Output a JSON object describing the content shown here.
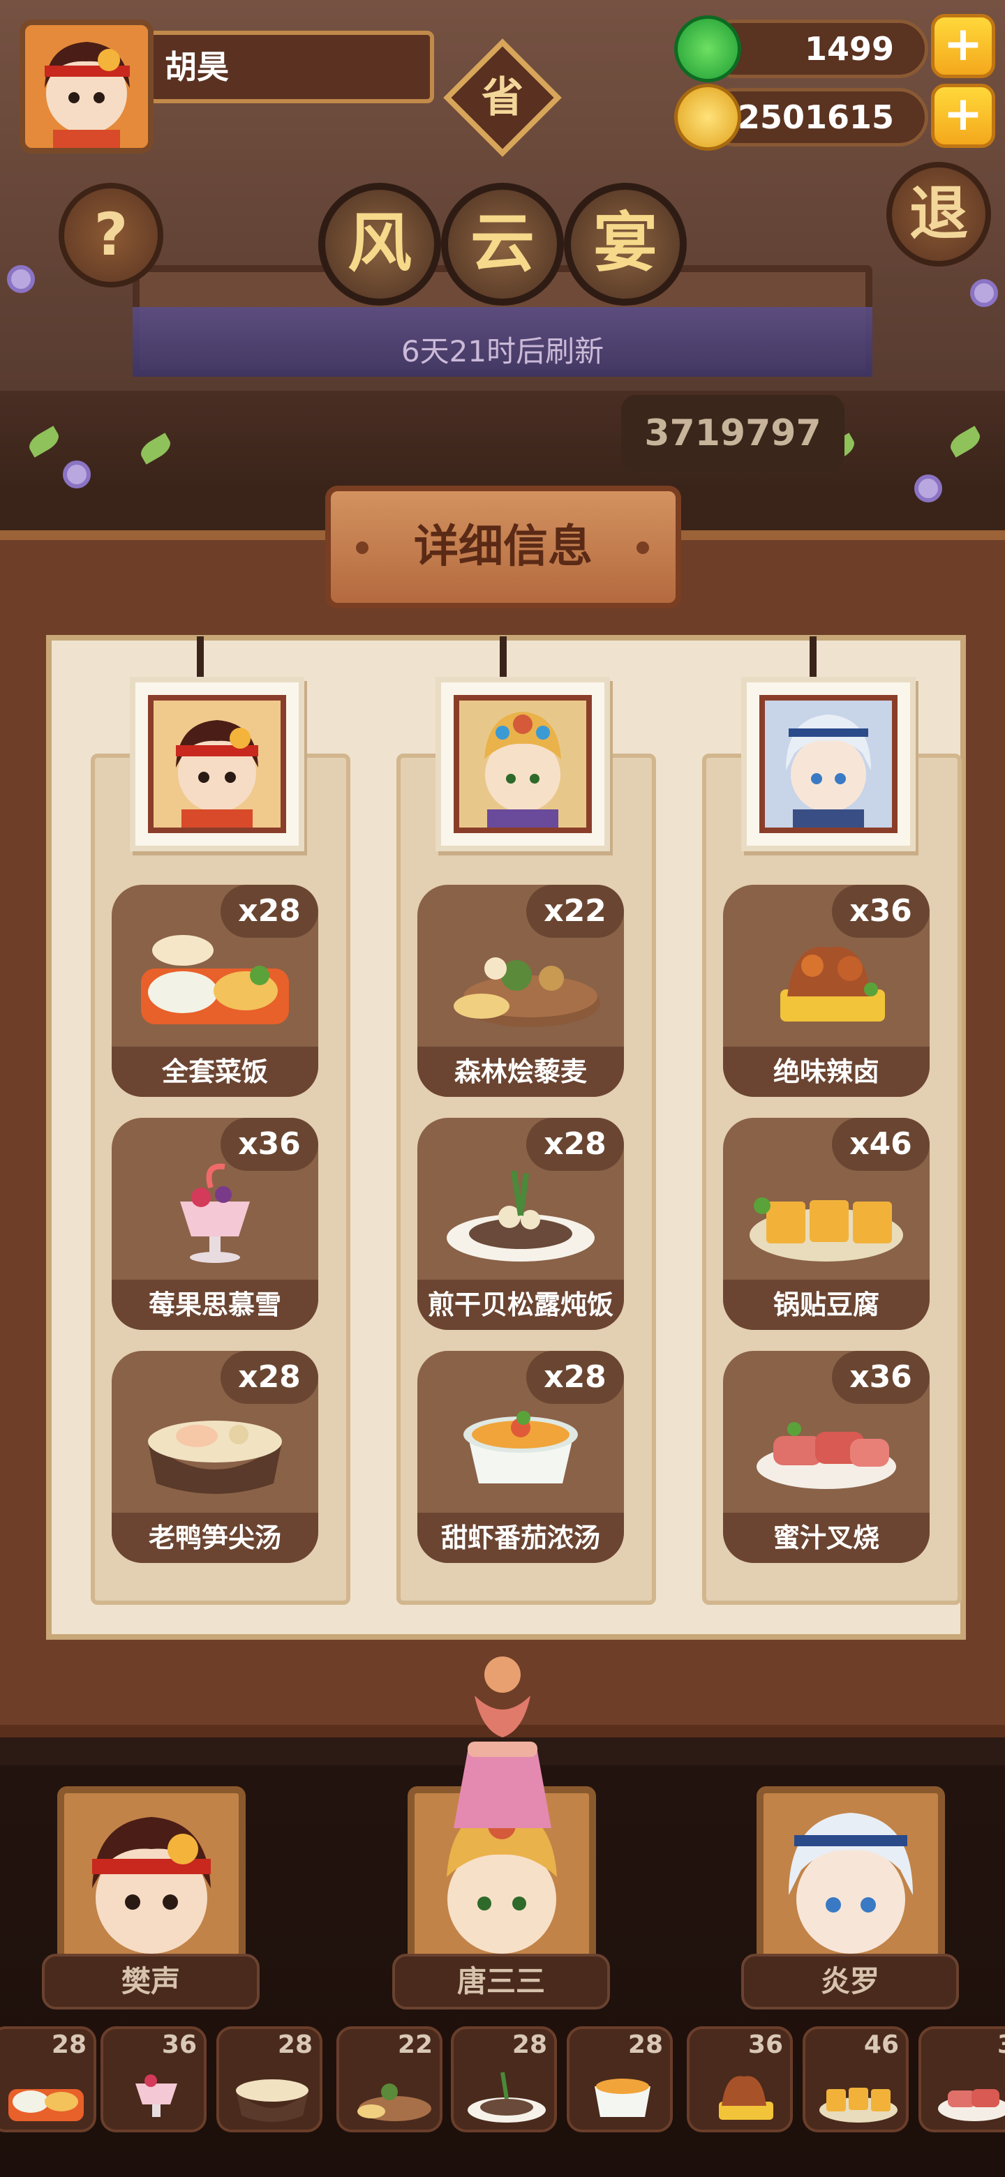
{
  "player": {
    "name": "胡昊",
    "avatar_icon": "red-haired-chef-avatar-icon"
  },
  "currencies": {
    "jade": {
      "value": "1499",
      "icon": "jade-icon",
      "plus_label": "+"
    },
    "coin": {
      "value": "2501615",
      "icon": "gold-coin-icon",
      "plus_label": "+"
    }
  },
  "buttons": {
    "help": "?",
    "exit": "退",
    "province": "省"
  },
  "event": {
    "title_chars": [
      "风",
      "云",
      "宴"
    ],
    "refresh": "6天21时后刷新",
    "score": "3719797"
  },
  "panel": {
    "title": "详细信息"
  },
  "chefs": [
    {
      "name": "樊声",
      "palette": {
        "hair": "#4a1e16",
        "band": "#c8281e",
        "skin": "#f6dcc4",
        "cloth": "#d84a2a"
      },
      "dishes": [
        {
          "name": "全套菜饭",
          "count": "x28",
          "icon": "full-set-rice-icon"
        },
        {
          "name": "莓果思慕雪",
          "count": "x36",
          "icon": "berry-smoothie-icon"
        },
        {
          "name": "老鸭笋尖汤",
          "count": "x28",
          "icon": "duck-bamboo-soup-icon"
        }
      ]
    },
    {
      "name": "唐三三",
      "palette": {
        "hair": "#e9b24a",
        "band": "#d45a3a",
        "skin": "#f7e0c8",
        "cloth": "#6a4a9a"
      },
      "dishes": [
        {
          "name": "森林烩藜麦",
          "count": "x22",
          "icon": "forest-quinoa-icon"
        },
        {
          "name": "煎干贝松露炖饭",
          "count": "x28",
          "icon": "scallop-truffle-risotto-icon"
        },
        {
          "name": "甜虾番茄浓汤",
          "count": "x28",
          "icon": "shrimp-tomato-soup-icon"
        }
      ]
    },
    {
      "name": "炎罗",
      "palette": {
        "hair": "#e8eef6",
        "band": "#2a4a8a",
        "skin": "#f7e6d8",
        "cloth": "#3a4e86"
      },
      "dishes": [
        {
          "name": "绝味辣卤",
          "count": "x36",
          "icon": "spicy-braised-icon"
        },
        {
          "name": "锅贴豆腐",
          "count": "x46",
          "icon": "potsticker-tofu-icon"
        },
        {
          "name": "蜜汁叉烧",
          "count": "x36",
          "icon": "honey-char-siu-icon"
        }
      ]
    }
  ],
  "strip": [
    {
      "count": "28",
      "icon": "full-set-rice-icon"
    },
    {
      "count": "36",
      "icon": "berry-smoothie-icon"
    },
    {
      "count": "28",
      "icon": "duck-bamboo-soup-icon"
    },
    {
      "count": "22",
      "icon": "forest-quinoa-icon"
    },
    {
      "count": "28",
      "icon": "scallop-truffle-risotto-icon"
    },
    {
      "count": "28",
      "icon": "shrimp-tomato-soup-icon"
    },
    {
      "count": "36",
      "icon": "spicy-braised-icon"
    },
    {
      "count": "46",
      "icon": "potsticker-tofu-icon"
    },
    {
      "count": "3",
      "icon": "honey-char-siu-icon"
    }
  ],
  "colors": {
    "panel_bg": "#efe3cf",
    "card": "#8a6248",
    "accent_gold": "#f4a81c",
    "frame_wood": "#6e3e28"
  }
}
